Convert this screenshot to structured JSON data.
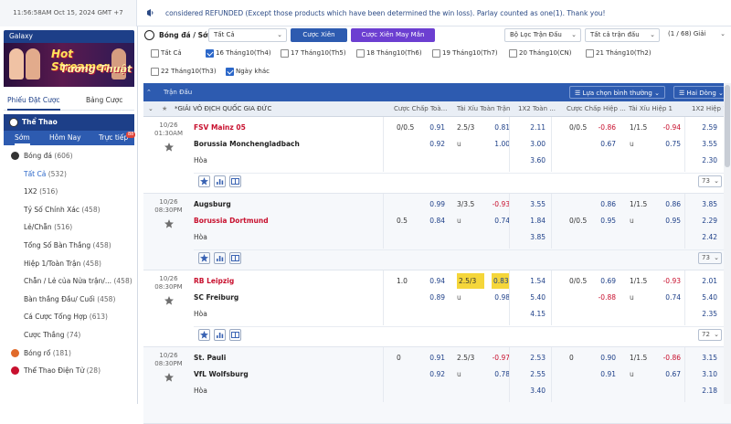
{
  "topbar": {
    "clock": "11:56:58AM Oct 15, 2024 GMT +7",
    "notice": "considered REFUNDED (Except those products which have been determined the win loss). Parlay counted as one(1). Thank you!"
  },
  "sidebar": {
    "galaxy_label": "Galaxy",
    "banner_line1": "Hot Streamer",
    "banner_line2": "Tướng Thuật",
    "tabs": [
      "Phiếu Đặt Cược",
      "Bảng Cược"
    ],
    "sport_header": "Thể Thao",
    "subtabs": [
      "Sớm",
      "Hôm Nay",
      "Trực tiếp"
    ],
    "live_badge": "88",
    "items": [
      {
        "label": "Bóng đá",
        "count": "(606)",
        "kind": "main"
      },
      {
        "label": "Tất Cả",
        "count": "(532)",
        "kind": "active"
      },
      {
        "label": "1X2",
        "count": "(516)",
        "kind": "sub"
      },
      {
        "label": "Tỷ Số Chính Xác",
        "count": "(458)",
        "kind": "sub"
      },
      {
        "label": "Lẻ/Chẵn",
        "count": "(516)",
        "kind": "sub"
      },
      {
        "label": "Tổng Số Bàn Thắng",
        "count": "(458)",
        "kind": "sub"
      },
      {
        "label": "Hiệp 1/Toàn Trận",
        "count": "(458)",
        "kind": "sub"
      },
      {
        "label": "Chẵn / Lẻ của Nửa trận/...",
        "count": "(458)",
        "kind": "sub"
      },
      {
        "label": "Bàn thắng Đầu/ Cuối",
        "count": "(458)",
        "kind": "sub"
      },
      {
        "label": "Cá Cược Tổng Hợp",
        "count": "(613)",
        "kind": "sub"
      },
      {
        "label": "Cược Thắng",
        "count": "(74)",
        "kind": "sub"
      },
      {
        "label": "Bóng rổ",
        "count": "(181)",
        "kind": "main"
      },
      {
        "label": "Thể Thao Điện Tử",
        "count": "(28)",
        "kind": "main"
      }
    ]
  },
  "filter": {
    "title": "Bóng đá / Sớm",
    "all_select": "Tất Cả",
    "parlay_btn": "Cược Xiên",
    "random_parlay_btn": "Cược Xiên May Mắn",
    "match_filter": "Bộ Lọc Trận Đấu",
    "odds_select": "Tất cả trận đấu",
    "pages": "(1 / 68) Giải",
    "dates": [
      {
        "label": "Tất Cả",
        "checked": false
      },
      {
        "label": "16 Tháng10(Th4)",
        "checked": true
      },
      {
        "label": "17 Tháng10(Th5)",
        "checked": false
      },
      {
        "label": "18 Tháng10(Th6)",
        "checked": false
      },
      {
        "label": "19 Tháng10(Th7)",
        "checked": false
      },
      {
        "label": "20 Tháng10(CN)",
        "checked": false
      },
      {
        "label": "21 Tháng10(Th2)",
        "checked": false
      },
      {
        "label": "22 Tháng10(Th3)",
        "checked": false
      },
      {
        "label": "Ngày khác",
        "checked": true
      }
    ]
  },
  "header": {
    "match_col": "Trận Đấu",
    "sort_btn": "Lựa chọn bình thường",
    "market_btn": "Hai Dòng"
  },
  "columns": {
    "league": "*GIẢI VÔ ĐỊCH QUỐC GIA ĐỨC",
    "c1": "Cược Chấp Toà...",
    "c2": "Tài Xỉu Toàn Trận",
    "c3": "1X2 Toàn ...",
    "c4": "Cược Chấp Hiệp ...",
    "c5": "Tài Xỉu Hiệp 1",
    "c6": "1X2 Hiệp 1"
  },
  "matches": [
    {
      "date": "10/26",
      "time": "01:30AM",
      "home": "FSV Mainz 05",
      "away": "Borussia Monchengladbach",
      "draw": "Hòa",
      "home_red": true,
      "away_red": false,
      "more": "73",
      "home_odds": {
        "hdp": "0/0.5",
        "hdp_o": "0.91",
        "ou": "2.5/3",
        "ou_o": "0.81",
        "x": "2.11",
        "hdp1": "0/0.5",
        "hdp1_o": "-0.86",
        "ou1": "1/1.5",
        "ou1_o": "-0.94",
        "x1": "2.59"
      },
      "away_odds": {
        "hdp": "",
        "hdp_o": "0.92",
        "ou": "u",
        "ou_o": "1.00",
        "x": "3.00",
        "hdp1": "",
        "hdp1_o": "0.67",
        "ou1": "u",
        "ou1_o": "0.75",
        "x1": "3.55"
      },
      "draw_odds": {
        "x": "3.60",
        "x1": "2.30"
      }
    },
    {
      "date": "10/26",
      "time": "08:30PM",
      "home": "Augsburg",
      "away": "Borussia Dortmund",
      "draw": "Hòa",
      "home_red": false,
      "away_red": true,
      "more": "73",
      "home_odds": {
        "hdp": "",
        "hdp_o": "0.99",
        "ou": "3/3.5",
        "ou_o": "-0.93",
        "x": "3.55",
        "hdp1": "",
        "hdp1_o": "0.86",
        "ou1": "1/1.5",
        "ou1_o": "0.86",
        "x1": "3.85"
      },
      "away_odds": {
        "hdp": "0.5",
        "hdp_o": "0.84",
        "ou": "u",
        "ou_o": "0.74",
        "x": "1.84",
        "hdp1": "0/0.5",
        "hdp1_o": "0.95",
        "ou1": "u",
        "ou1_o": "0.95",
        "x1": "2.29"
      },
      "draw_odds": {
        "x": "3.85",
        "x1": "2.42"
      }
    },
    {
      "date": "10/26",
      "time": "08:30PM",
      "home": "RB Leipzig",
      "away": "SC Freiburg",
      "draw": "Hòa",
      "home_red": true,
      "away_red": false,
      "more": "72",
      "home_odds": {
        "hdp": "1.0",
        "hdp_o": "0.94",
        "ou": "2.5/3",
        "ou_o": "0.83",
        "x": "1.54",
        "hdp1": "0/0.5",
        "hdp1_o": "0.69",
        "ou1": "1/1.5",
        "ou1_o": "-0.93",
        "x1": "2.01"
      },
      "away_odds": {
        "hdp": "",
        "hdp_o": "0.89",
        "ou": "u",
        "ou_o": "0.98",
        "x": "5.40",
        "hdp1": "",
        "hdp1_o": "-0.88",
        "ou1": "u",
        "ou1_o": "0.74",
        "x1": "5.40"
      },
      "draw_odds": {
        "x": "4.15",
        "x1": "2.35"
      }
    },
    {
      "date": "10/26",
      "time": "08:30PM",
      "home": "St. Pauli",
      "away": "VfL Wolfsburg",
      "draw": "Hòa",
      "home_red": false,
      "away_red": false,
      "more": "",
      "home_odds": {
        "hdp": "0",
        "hdp_o": "0.91",
        "ou": "2.5/3",
        "ou_o": "-0.97",
        "x": "2.53",
        "hdp1": "0",
        "hdp1_o": "0.90",
        "ou1": "1/1.5",
        "ou1_o": "-0.86",
        "x1": "3.15"
      },
      "away_odds": {
        "hdp": "",
        "hdp_o": "0.92",
        "ou": "u",
        "ou_o": "0.78",
        "x": "2.55",
        "hdp1": "",
        "hdp1_o": "0.91",
        "ou1": "u",
        "ou1_o": "0.67",
        "x1": "3.10"
      },
      "draw_odds": {
        "x": "3.40",
        "x1": "2.18"
      }
    }
  ],
  "colors": {
    "primary": "#1d3f88",
    "header": "#2d5bb0",
    "accent_purple": "#6c3fd1",
    "negative": "#c8102e",
    "odds": "#1d3f88",
    "highlight": "#f5d63a"
  }
}
